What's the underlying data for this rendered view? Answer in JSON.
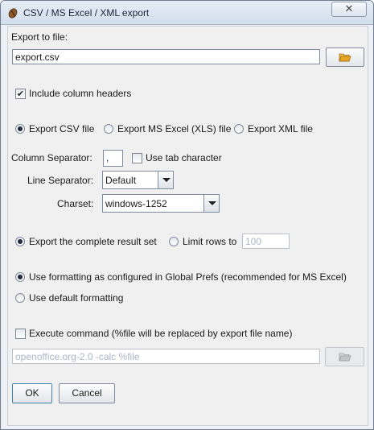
{
  "window": {
    "title": "CSV / MS Excel / XML export",
    "close_symbol": "✕"
  },
  "export_file": {
    "label": "Export to file:",
    "value": "export.csv",
    "browse_icon": "folder-open-icon"
  },
  "headers": {
    "label": "Include column headers",
    "checked": true
  },
  "format": {
    "options": [
      {
        "label": "Export CSV file",
        "selected": true
      },
      {
        "label": "Export MS Excel (XLS) file",
        "selected": false
      },
      {
        "label": "Export XML file",
        "selected": false
      }
    ]
  },
  "column_separator": {
    "label": "Column Separator:",
    "value": ",",
    "tab_label": "Use tab character",
    "tab_checked": false
  },
  "line_separator": {
    "label": "Line Separator:",
    "value": "Default"
  },
  "charset": {
    "label": "Charset:",
    "value": "windows-1252"
  },
  "rows": {
    "complete_label": "Export the complete result set",
    "limit_label": "Limit rows to",
    "limit_value": "100",
    "complete_selected": true
  },
  "formatting": {
    "global_label": "Use formatting as configured in Global Prefs (recommended for MS Excel)",
    "default_label": "Use default formatting",
    "global_selected": true
  },
  "command": {
    "label": "Execute command (%file will be replaced by export file name)",
    "checked": false,
    "value": "openoffice.org-2.0 -calc %file"
  },
  "buttons": {
    "ok": "OK",
    "cancel": "Cancel"
  },
  "colors": {
    "title_bar": "#dce5f0",
    "panel": "#f0f0f0",
    "folder": "#e8a623",
    "disabled_text": "#a9b6c9"
  }
}
